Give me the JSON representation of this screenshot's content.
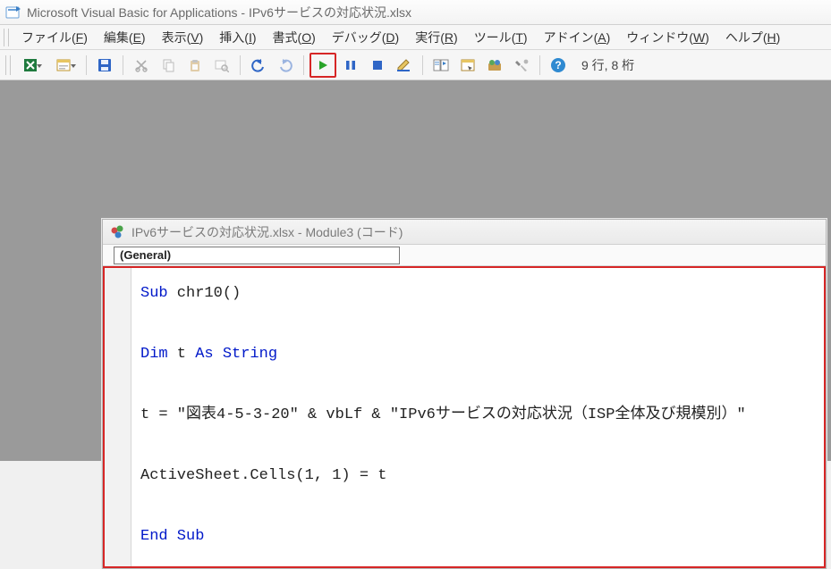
{
  "title": "Microsoft Visual Basic for Applications - IPv6サービスの対応状況.xlsx",
  "menu": {
    "file": {
      "label": "ファイル",
      "mn": "F"
    },
    "edit": {
      "label": "編集",
      "mn": "E"
    },
    "view": {
      "label": "表示",
      "mn": "V"
    },
    "insert": {
      "label": "挿入",
      "mn": "I"
    },
    "format": {
      "label": "書式",
      "mn": "O"
    },
    "debug": {
      "label": "デバッグ",
      "mn": "D"
    },
    "run": {
      "label": "実行",
      "mn": "R"
    },
    "tools": {
      "label": "ツール",
      "mn": "T"
    },
    "addins": {
      "label": "アドイン",
      "mn": "A"
    },
    "window": {
      "label": "ウィンドウ",
      "mn": "W"
    },
    "help": {
      "label": "ヘルプ",
      "mn": "H"
    }
  },
  "toolbar": {
    "status": "9 行, 8 桁"
  },
  "child": {
    "title": "IPv6サービスの対応状況.xlsx - Module3 (コード)",
    "object_combo": "(General)"
  },
  "code": {
    "l1a": "Sub",
    "l1b": " chr10()",
    "l2_dim": "Dim",
    "l2_mid": " t ",
    "l2_as": "As String",
    "l3": "t = \"図表4-5-3-20\" & vbLf & \"IPv6サービスの対応状況（ISP全体及び規模別）\"",
    "l4": "ActiveSheet.Cells(1, 1) = t",
    "l5": "End Sub"
  }
}
